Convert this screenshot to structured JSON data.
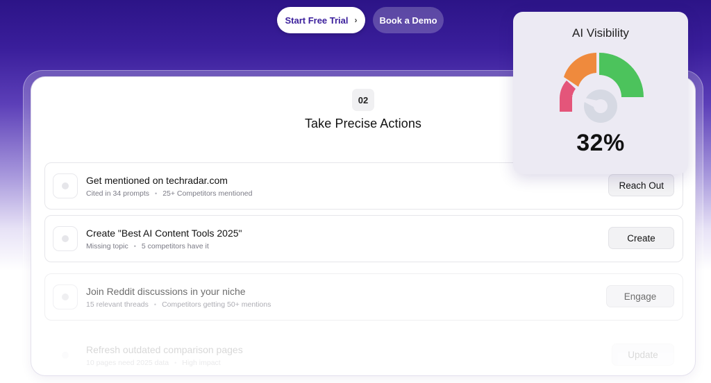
{
  "cta": {
    "trial_label": "Start Free Trial",
    "demo_label": "Book a Demo"
  },
  "section": {
    "step": "02",
    "title": "Take Precise Actions"
  },
  "actions": [
    {
      "title": "Get mentioned on techradar.com",
      "meta": [
        "Cited in 34 prompts",
        "25+ Competitors mentioned"
      ],
      "button": "Reach Out"
    },
    {
      "title": "Create \"Best AI Content Tools 2025\"",
      "meta": [
        "Missing topic",
        "5 competitors have it"
      ],
      "button": "Create"
    },
    {
      "title": "Join Reddit discussions in your niche",
      "meta": [
        "15 relevant threads",
        "Competitors getting 50+ mentions"
      ],
      "button": "Engage"
    },
    {
      "title": "Refresh outdated comparison pages",
      "meta": [
        "10 pages need 2025 data",
        "High impact"
      ],
      "button": "Update"
    }
  ],
  "visibility": {
    "title": "AI Visibility",
    "value_label": "32%",
    "value": 0.32,
    "gauge_colors": {
      "low": "#e4557a",
      "mid": "#ef8a3d",
      "high": "#4cc35c",
      "track": "#d6d9e3"
    }
  },
  "colors": {
    "brand": "#3a1e9b"
  },
  "icons": {
    "trial_arrow": "chevron-right-icon",
    "row_icon": "dot-icon"
  }
}
